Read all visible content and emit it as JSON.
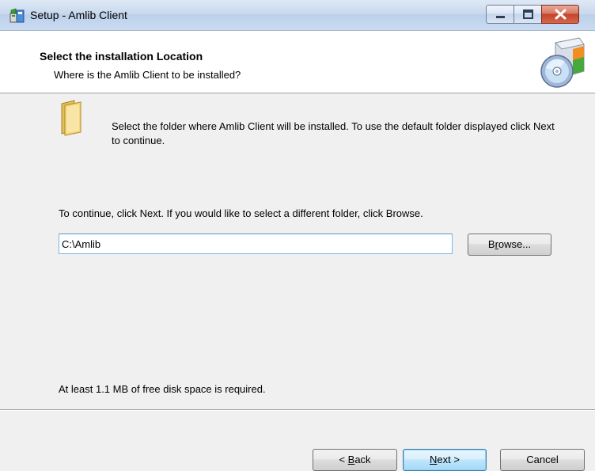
{
  "window": {
    "title": "Setup - Amlib Client",
    "icon": "setup-installer-icon"
  },
  "caption_buttons": {
    "minimize_icon": "minimize-icon",
    "maximize_icon": "maximize-icon",
    "close_icon": "close-icon"
  },
  "header": {
    "title": "Select the installation Location",
    "subtitle": "Where is the Amlib Client to be installed?",
    "logo": "setup-disc-box-icon"
  },
  "body": {
    "folder_icon": "folder-icon",
    "intro": "Select the folder where Amlib Client will be installed. To use the default folder displayed click Next to continue.",
    "continue_hint": "To continue, click Next. If you would like to select a different folder, click Browse.",
    "install_path": "C:\\Amlib",
    "browse": {
      "pre": "B",
      "accel": "r",
      "post": "owse..."
    },
    "disk_space": "At least 1.1 MB of free disk space is required."
  },
  "footer": {
    "back": {
      "pre": "< ",
      "accel": "B",
      "post": "ack"
    },
    "next": {
      "pre": "",
      "accel": "N",
      "post": "ext >"
    },
    "cancel": "Cancel"
  },
  "colors": {
    "title_bar": "#c9d9ee",
    "window_bg": "#f0f0f0",
    "header_bg": "#ffffff",
    "close_button": "#c4442a",
    "default_button_border": "#3c7fb1",
    "input_border": "#7eb4ea"
  }
}
